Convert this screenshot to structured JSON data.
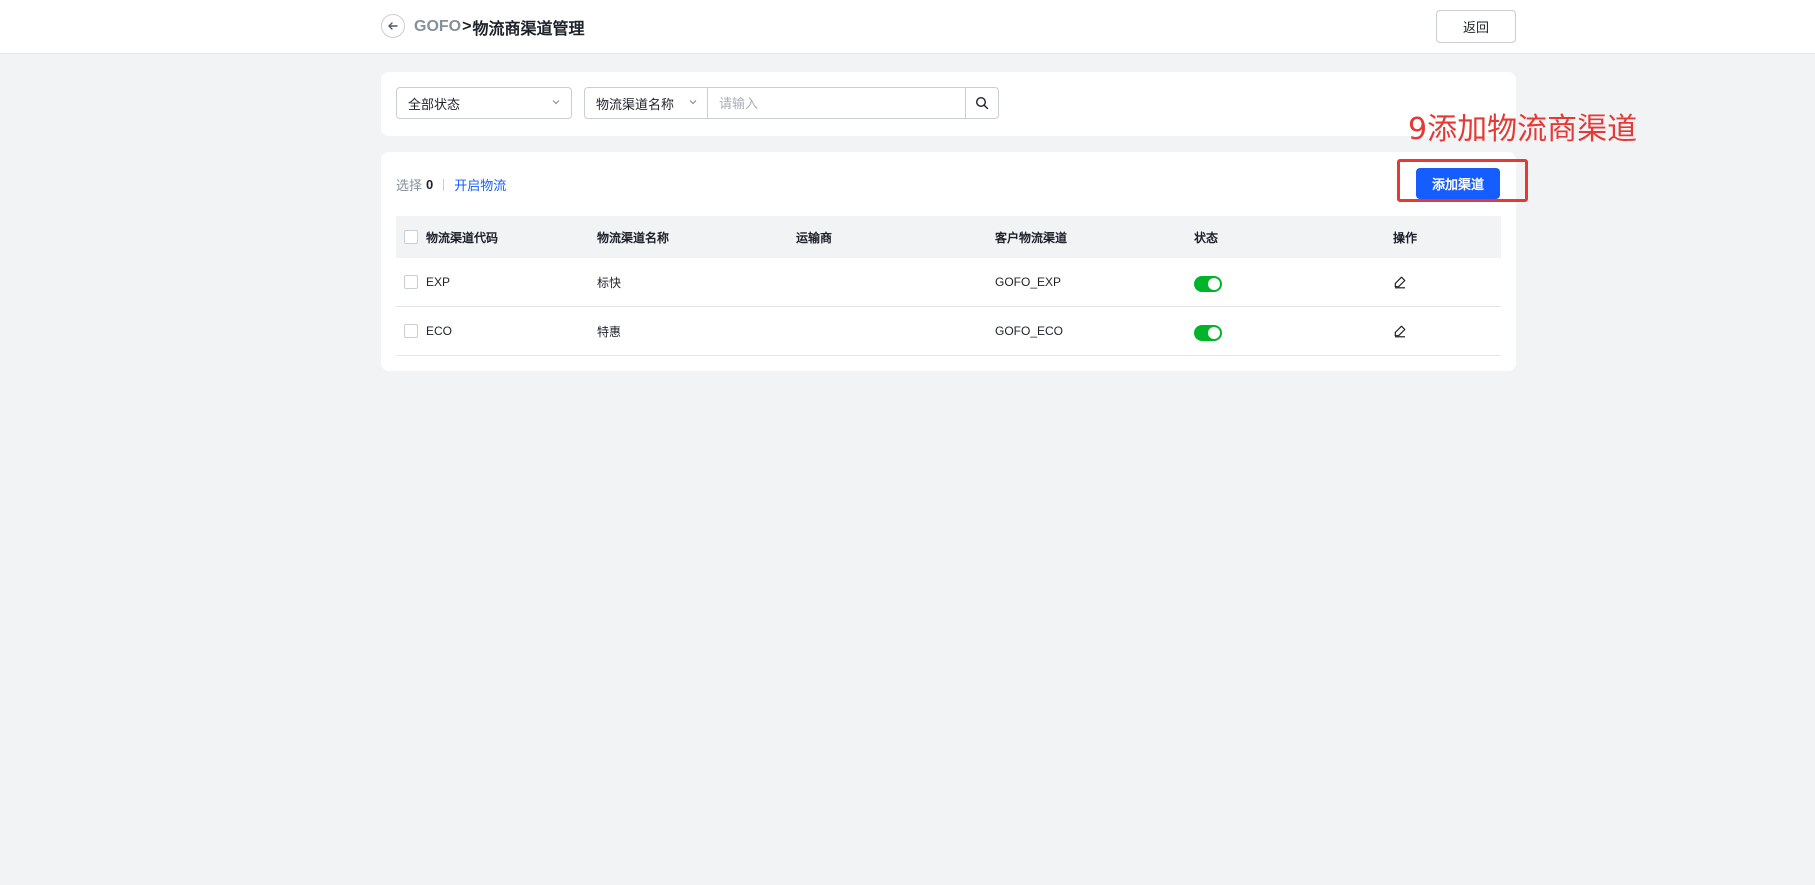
{
  "header": {
    "back_icon": "arrow-left-icon",
    "breadcrumb_root": "GOFO",
    "breadcrumb_separator": ">",
    "breadcrumb_current": "物流商渠道管理",
    "return_label": "返回"
  },
  "filters": {
    "status_select_value": "全部状态",
    "name_type_value": "物流渠道名称",
    "search_placeholder": "请输入",
    "search_icon": "search-icon"
  },
  "toolbar": {
    "selected_label": "选择",
    "selected_count": "0",
    "enable_link": "开启物流",
    "add_button": "添加渠道"
  },
  "table": {
    "columns": [
      "物流渠道代码",
      "物流渠道名称",
      "运输商",
      "客户物流渠道",
      "状态",
      "操作"
    ],
    "rows": [
      {
        "code": "EXP",
        "name": "标快",
        "carrier": "",
        "customer_channel": "GOFO_EXP",
        "status": "on"
      },
      {
        "code": "ECO",
        "name": "特惠",
        "carrier": "",
        "customer_channel": "GOFO_ECO",
        "status": "on"
      }
    ]
  },
  "annotation": {
    "text": "9添加物流商渠道",
    "color": "#e53935"
  },
  "colors": {
    "primary": "#165dff",
    "switch_on": "#00b42a",
    "background": "#f2f3f5"
  }
}
